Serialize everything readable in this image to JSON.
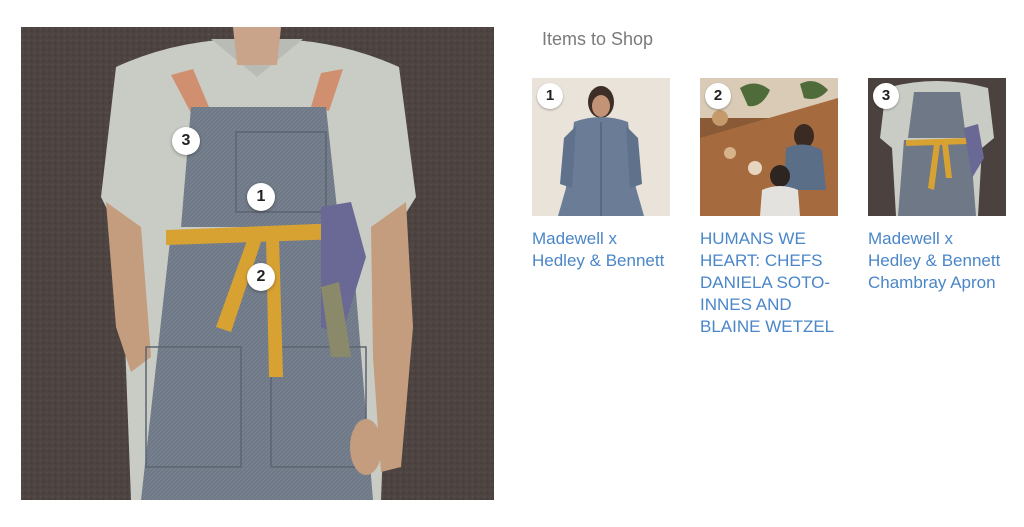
{
  "hero": {
    "image_description": "woman wearing a chambray apron with yellow ties holding lavender",
    "hotspots": [
      {
        "number": "1"
      },
      {
        "number": "2"
      },
      {
        "number": "3"
      }
    ]
  },
  "shop": {
    "heading": "Items to Shop",
    "items": [
      {
        "number": "1",
        "title": "Madewell x Hedley & Bennett"
      },
      {
        "number": "2",
        "title": "HUMANS WE HEART: CHEFS DANIELA SOTO-INNES AND BLAINE WETZEL"
      },
      {
        "number": "3",
        "title": "Madewell x Hedley & Bennett Chambray Apron"
      }
    ]
  },
  "colors": {
    "link": "#4a86c8",
    "heading": "#7a7a7a",
    "apron": "#6e7785",
    "strap": "#d8a233",
    "wall": "#4b423f"
  }
}
